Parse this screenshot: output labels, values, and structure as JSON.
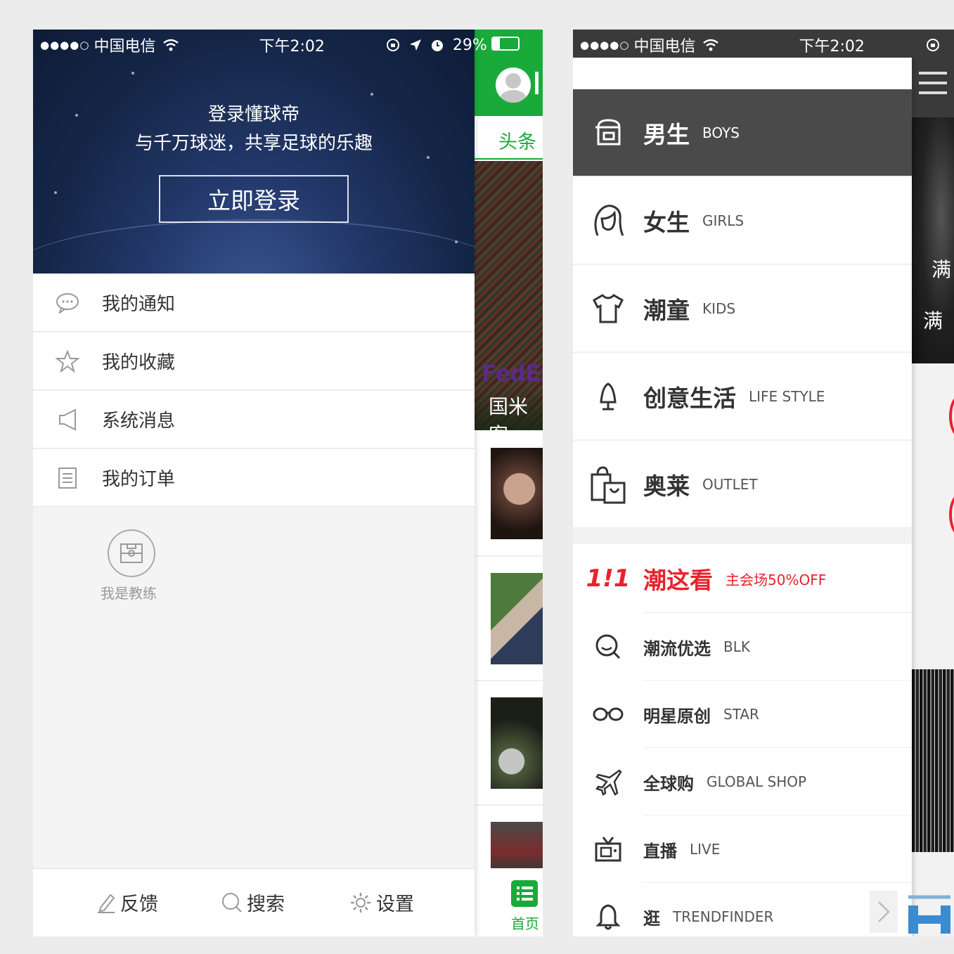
{
  "left_phone": {
    "status_bar": {
      "signal": "●●●●○",
      "carrier": "中国电信",
      "time": "下午2:02",
      "battery": "29%"
    },
    "login_header": {
      "title": "登录懂球帝",
      "subtitle": "与千万球迷，共享足球的乐趣",
      "button": "立即登录"
    },
    "menu": [
      {
        "icon": "chat-bubble-icon",
        "label": "我的通知"
      },
      {
        "icon": "star-icon",
        "label": "我的收藏"
      },
      {
        "icon": "megaphone-icon",
        "label": "系统消息"
      },
      {
        "icon": "list-icon",
        "label": "我的订单"
      }
    ],
    "coach": {
      "label": "我是教练"
    },
    "bottom_bar": {
      "feedback": "反馈",
      "search": "搜索",
      "settings": "设置"
    },
    "background_app": {
      "tab": "头条",
      "feature_logo": "FedEx",
      "feature_caption": "国米客",
      "home_tab": "首页"
    }
  },
  "right_phone": {
    "status_bar": {
      "signal": "●●●●○",
      "carrier": "中国电信",
      "time": "下午2:02"
    },
    "categories": [
      {
        "zh": "男生",
        "en": "BOYS",
        "active": true
      },
      {
        "zh": "女生",
        "en": "GIRLS",
        "active": false
      },
      {
        "zh": "潮童",
        "en": "KIDS",
        "active": false
      },
      {
        "zh": "创意生活",
        "en": "LIFE STYLE",
        "active": false
      },
      {
        "zh": "奥莱",
        "en": "OUTLET",
        "active": false
      }
    ],
    "promo": {
      "logo": "1!1",
      "title": "潮这看",
      "subtitle": "主会场50%OFF"
    },
    "sub_items": [
      {
        "zh": "潮流优选",
        "en": "BLK"
      },
      {
        "zh": "明星原创",
        "en": "STAR"
      },
      {
        "zh": "全球购",
        "en": "GLOBAL SHOP"
      },
      {
        "zh": "直播",
        "en": "LIVE"
      },
      {
        "zh": "逛",
        "en": "TRENDFINDER"
      }
    ],
    "background_app": {
      "text1": "满",
      "text2": "满"
    }
  },
  "colors": {
    "green": "#1aaa3a",
    "red": "#e8222c",
    "dark": "#4a4a4a",
    "navy": "#1a2c55"
  }
}
